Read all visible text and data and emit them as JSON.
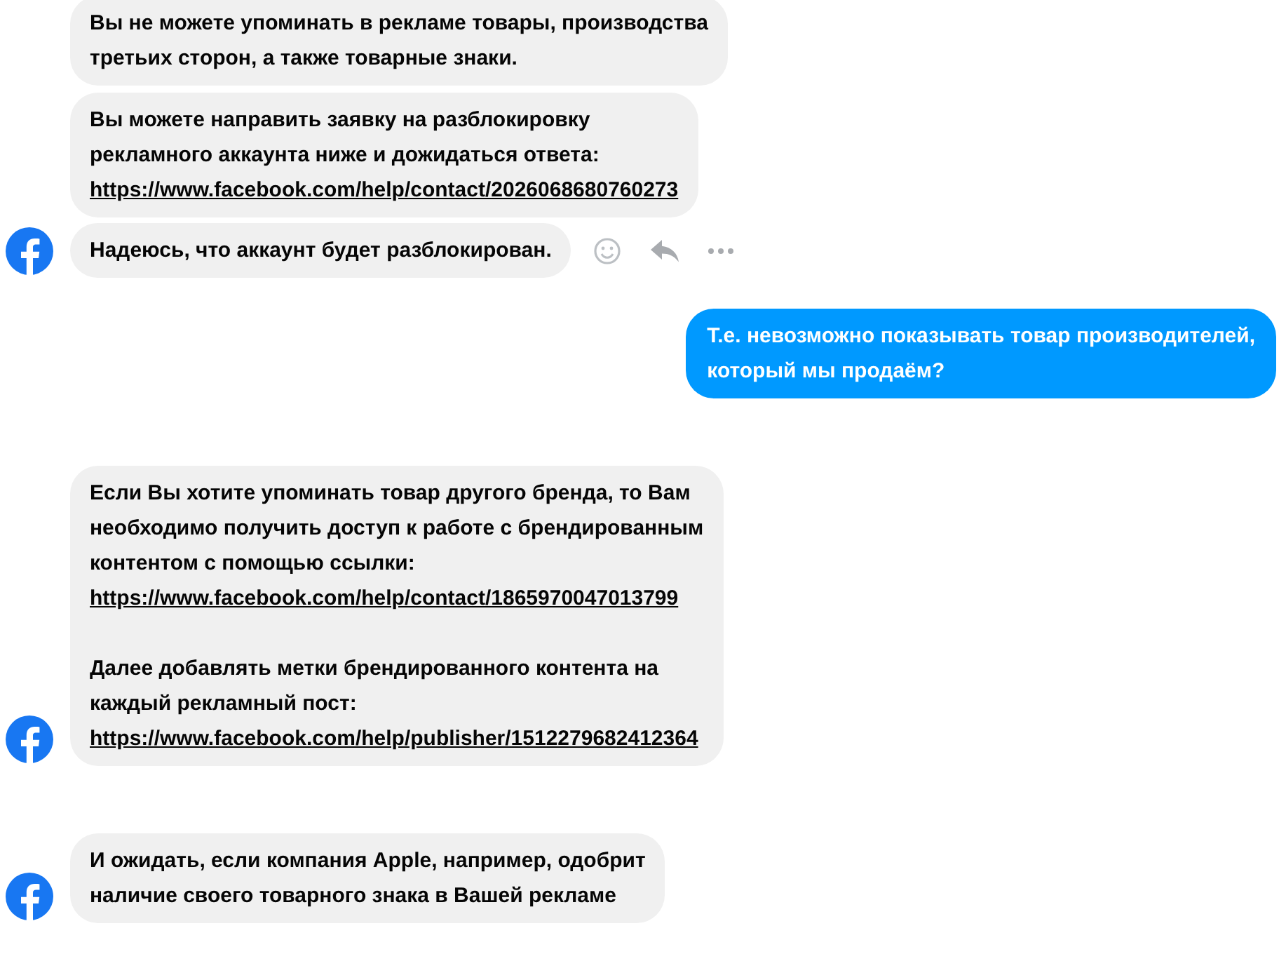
{
  "messages": [
    {
      "kind": "received",
      "avatar": false,
      "blocks": [
        {
          "kind": "text",
          "text": "Вы не можете упоминать в рекламе товары, производства\nтретьих сторон, а также товарные знаки."
        }
      ]
    },
    {
      "kind": "received",
      "avatar": false,
      "blocks": [
        {
          "kind": "text",
          "text": "Вы можете направить заявку на разблокировку\nрекламного аккаунта ниже и дожидаться ответа:"
        },
        {
          "kind": "link",
          "text": "https://www.facebook.com/help/contact/2026068680760273"
        }
      ]
    },
    {
      "kind": "received",
      "avatar": true,
      "actions": true,
      "blocks": [
        {
          "kind": "text",
          "text": "Надеюсь, что аккаунт будет разблокирован."
        }
      ]
    },
    {
      "kind": "sent",
      "blocks": [
        {
          "kind": "text",
          "text": "Т.е. невозможно показывать товар производителей,\nкоторый мы продаём?"
        }
      ]
    },
    {
      "kind": "received",
      "avatar": true,
      "blocks": [
        {
          "kind": "text",
          "text": "Если Вы хотите упоминать товар другого бренда, то Вам\nнеобходимо получить доступ к работе с брендированным\nконтентом с помощью ссылки:"
        },
        {
          "kind": "link",
          "text": "https://www.facebook.com/help/contact/1865970047013799"
        },
        {
          "kind": "text",
          "spaced": true,
          "text": "Далее добавлять метки брендированного контента на\nкаждый рекламный пост:"
        },
        {
          "kind": "link",
          "text": "https://www.facebook.com/help/publisher/1512279682412364"
        }
      ]
    },
    {
      "kind": "received",
      "avatar": true,
      "blocks": [
        {
          "kind": "text",
          "text": "И ожидать, если компания Apple, например, одобрит\nналичие своего товарного знака в Вашей рекламе"
        }
      ]
    }
  ]
}
